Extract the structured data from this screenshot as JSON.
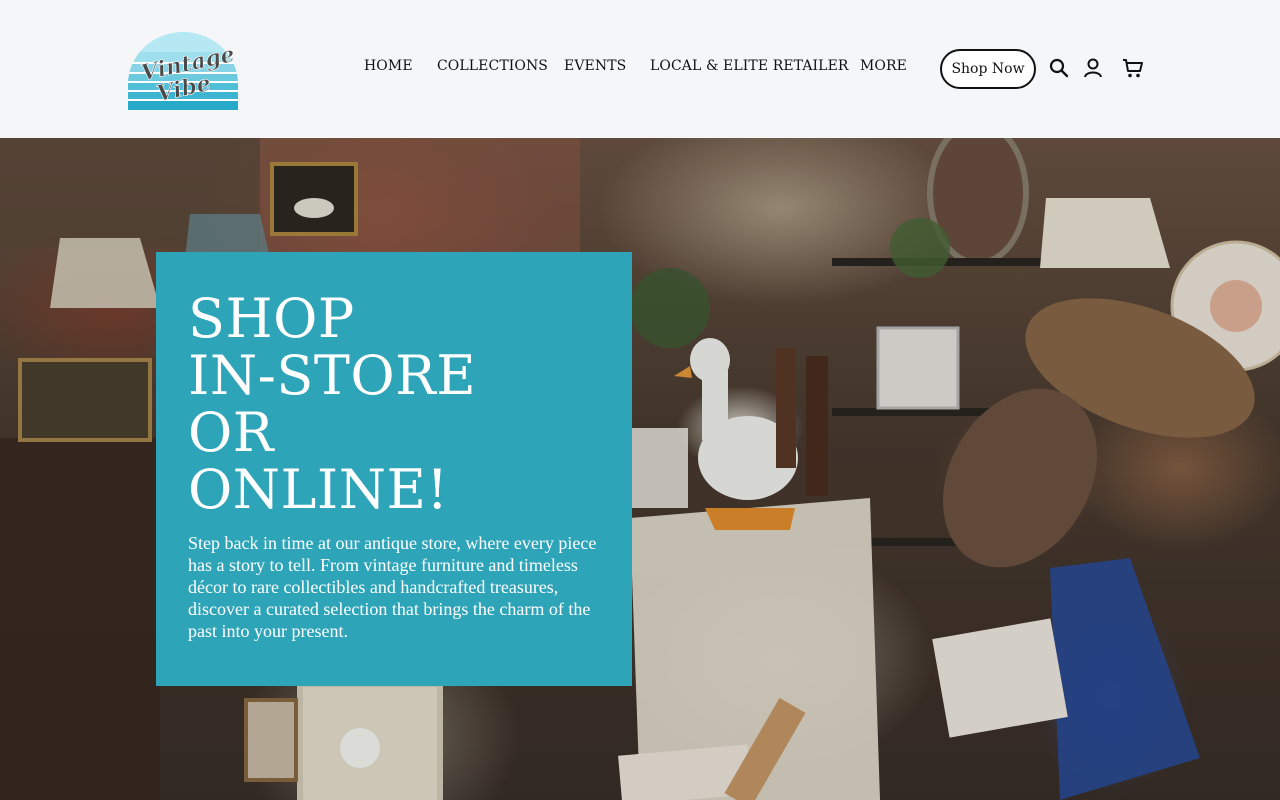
{
  "header": {
    "logo": {
      "line1": "Vintage",
      "line2": "Vibe",
      "colors": {
        "light": "#a8e3ef",
        "mid": "#62c6dd",
        "dark": "#27a9c9"
      }
    },
    "nav": [
      {
        "label": "HOME"
      },
      {
        "label": "COLLECTIONS"
      },
      {
        "label": "EVENTS"
      },
      {
        "label": "LOCAL & ELITE RETAILER"
      },
      {
        "label": "MORE"
      }
    ],
    "shop_button": "Shop Now",
    "icons": [
      "search-icon",
      "account-icon",
      "cart-icon"
    ]
  },
  "hero": {
    "title_lines": [
      "SHOP",
      "IN-STORE",
      "OR",
      "ONLINE!"
    ],
    "description": "Step back in time at our antique store, where every piece has a story to tell. From vintage furniture and timeless décor to rare collectibles and handcrafted treasures, discover a curated selection that brings the charm of the past into your present.",
    "box_color": "#2ea4b8"
  }
}
